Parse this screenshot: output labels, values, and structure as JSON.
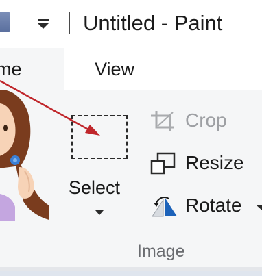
{
  "titlebar": {
    "title": "Untitled - Paint",
    "qat_icon": "customize-quick-access-arrow-icon"
  },
  "tabs": [
    {
      "label": "me",
      "active": true
    },
    {
      "label": "View",
      "active": false
    }
  ],
  "ribbon": {
    "group_label": "Image",
    "select": {
      "label": "Select",
      "icon": "rectangular-selection-icon",
      "dropdown": "chevron-down-icon"
    },
    "tools": [
      {
        "label": "Crop",
        "icon": "crop-icon",
        "enabled": false
      },
      {
        "label": "Resize",
        "icon": "resize-icon",
        "enabled": true
      },
      {
        "label": "Rotate",
        "icon": "rotate-icon",
        "enabled": true
      }
    ]
  },
  "colors": {
    "ribbon_bg": "#f5f6f7",
    "pointer_arrow": "#c0262b",
    "disabled_text": "#9ea0a4",
    "rotate_icon_blue": "#1c62b9"
  }
}
